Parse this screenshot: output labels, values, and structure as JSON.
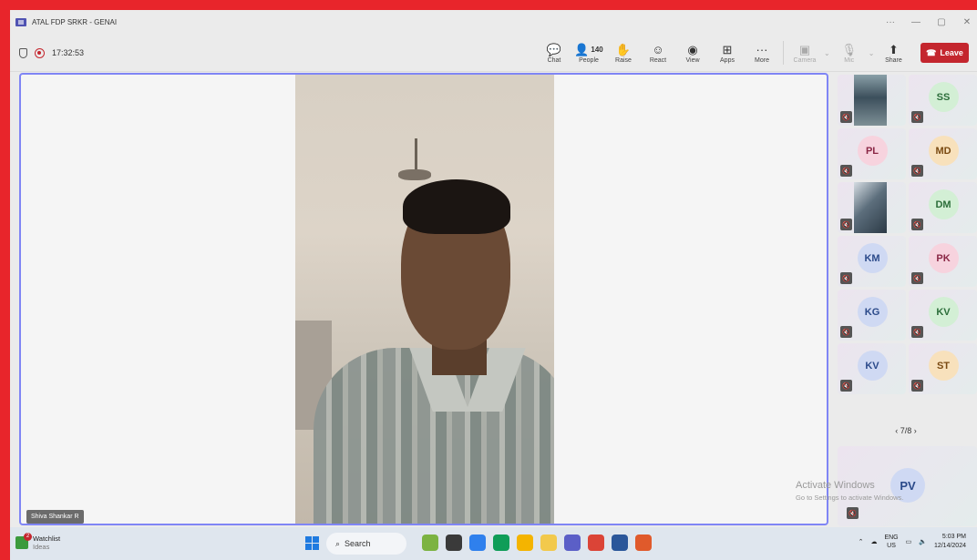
{
  "window": {
    "title": "ATAL FDP SRKR - GENAI",
    "controls": [
      "···",
      "—",
      "▢",
      "✕"
    ]
  },
  "meeting": {
    "timer": "17:32:53",
    "toolbar": [
      {
        "id": "chat",
        "label": "Chat",
        "icon": "chat-icon"
      },
      {
        "id": "people",
        "label": "People",
        "count": "140",
        "icon": "people-icon"
      },
      {
        "id": "raise",
        "label": "Raise",
        "icon": "hand-icon"
      },
      {
        "id": "react",
        "label": "React",
        "icon": "smiley-icon"
      },
      {
        "id": "view",
        "label": "View",
        "icon": "view-icon"
      },
      {
        "id": "apps",
        "label": "Apps",
        "icon": "plus-icon"
      },
      {
        "id": "more",
        "label": "More",
        "icon": "ellipsis-icon"
      }
    ],
    "av_controls": [
      {
        "id": "camera",
        "label": "Camera"
      },
      {
        "id": "mic",
        "label": "Mic"
      },
      {
        "id": "share",
        "label": "Share"
      }
    ],
    "leave_label": "Leave",
    "speaker_name": "Shiva Shankar R",
    "gallery": [
      {
        "initials": "",
        "photo": true
      },
      {
        "initials": "SS",
        "bg": "#d3efd5",
        "fg": "#2c6e3a"
      },
      {
        "initials": "PL",
        "bg": "#f7d3de",
        "fg": "#8a2745"
      },
      {
        "initials": "MD",
        "bg": "#f8e1bc",
        "fg": "#7a4a12"
      },
      {
        "initials": "",
        "photo": true
      },
      {
        "initials": "DM",
        "bg": "#d3efd5",
        "fg": "#2c6e3a"
      },
      {
        "initials": "KM",
        "bg": "#cfd9f3",
        "fg": "#2b4a8a"
      },
      {
        "initials": "PK",
        "bg": "#f7d3de",
        "fg": "#8a2745"
      },
      {
        "initials": "KG",
        "bg": "#cfd9f3",
        "fg": "#2b4a8a"
      },
      {
        "initials": "KV",
        "bg": "#d3efd5",
        "fg": "#2c6e3a"
      },
      {
        "initials": "KV",
        "bg": "#cfd9f3",
        "fg": "#2b4a8a"
      },
      {
        "initials": "ST",
        "bg": "#f8e1bc",
        "fg": "#7a4a12"
      }
    ],
    "pager": "7/8",
    "pinned_participant": "PV"
  },
  "activation": {
    "line1": "Activate Windows",
    "line2": "Go to Settings to activate Windows."
  },
  "taskbar": {
    "widget_title": "Watchlist",
    "widget_subtitle": "Ideas",
    "search_placeholder": "Search",
    "lang_top": "ENG",
    "lang_bottom": "US",
    "time": "5:03 PM",
    "date": "12/14/2024"
  }
}
